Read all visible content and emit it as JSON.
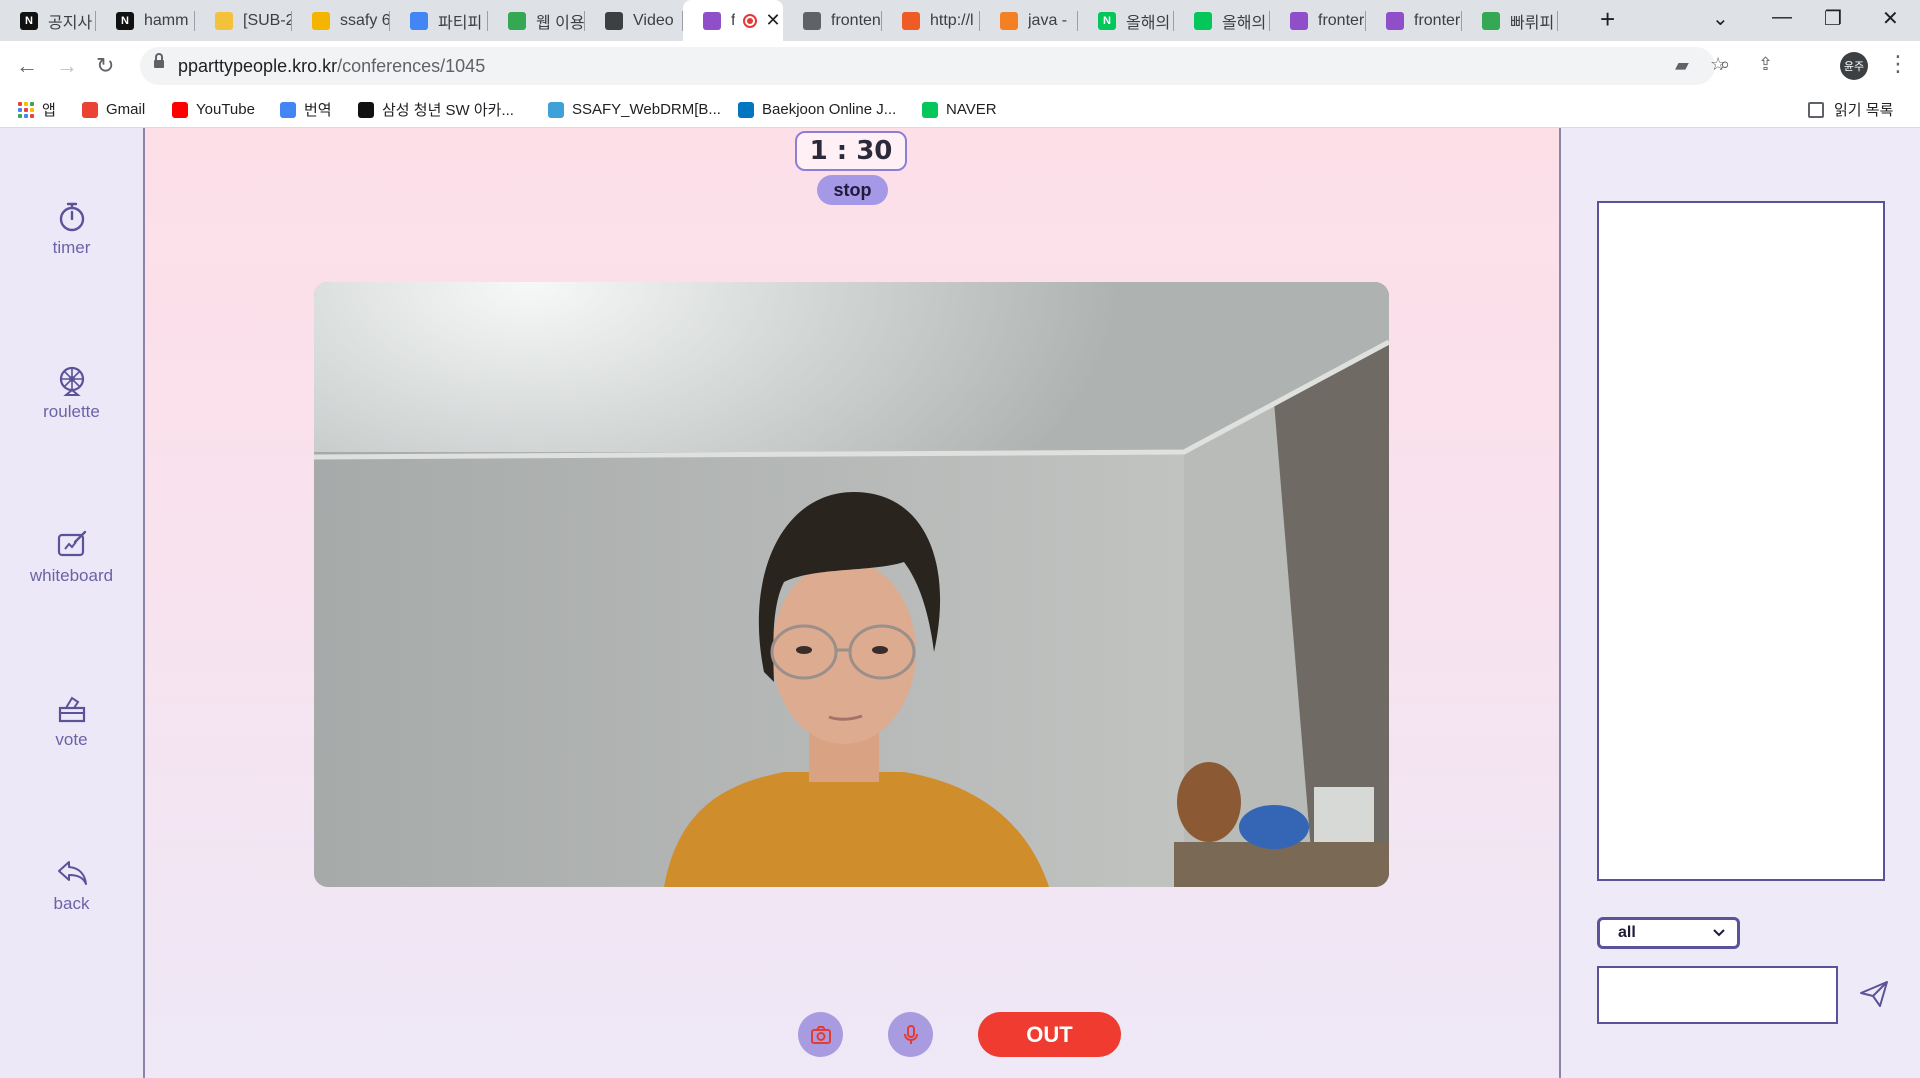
{
  "browser": {
    "tabs": [
      {
        "label": "공지사",
        "icon": "notion-icon",
        "color": "#111111",
        "glyph": "N"
      },
      {
        "label": "hamm",
        "icon": "notion-icon",
        "color": "#111111",
        "glyph": "N"
      },
      {
        "label": "[SUB-2",
        "icon": "emoji-icon",
        "color": "#f3c23c",
        "glyph": ""
      },
      {
        "label": "ssafy 6",
        "icon": "slides-icon",
        "color": "#f4b400",
        "glyph": ""
      },
      {
        "label": "파티피",
        "icon": "docs-icon",
        "color": "#4285f4",
        "glyph": ""
      },
      {
        "label": "웹 이용",
        "icon": "drive-icon",
        "color": "#34a853",
        "glyph": ""
      },
      {
        "label": "Video",
        "icon": "video-icon",
        "color": "#3c4043",
        "glyph": ""
      },
      {
        "label": "f",
        "icon": "app-logo-icon",
        "color": "#8e4fc8",
        "glyph": "",
        "active": true
      },
      {
        "label": "fronten",
        "icon": "globe-icon",
        "color": "#5f6368",
        "glyph": ""
      },
      {
        "label": "http://l",
        "icon": "postman-icon",
        "color": "#ef5b25",
        "glyph": ""
      },
      {
        "label": "java -",
        "icon": "stackoverflow-icon",
        "color": "#f48024",
        "glyph": ""
      },
      {
        "label": "올해의",
        "icon": "naver-icon",
        "color": "#03c75a",
        "glyph": "N"
      },
      {
        "label": "올해의",
        "icon": "blog-icon",
        "color": "#03c75a",
        "glyph": ""
      },
      {
        "label": "fronter",
        "icon": "app-logo-icon",
        "color": "#8e4fc8",
        "glyph": ""
      },
      {
        "label": "fronter",
        "icon": "app-logo-icon",
        "color": "#8e4fc8",
        "glyph": ""
      },
      {
        "label": "빠뤼피",
        "icon": "drive-icon",
        "color": "#34a853",
        "glyph": ""
      }
    ],
    "url_domain": "pparttypeople.kro.kr",
    "url_path": "/conferences/1045",
    "profile_initials": "윤주",
    "bookmarks": [
      {
        "label": "앱",
        "icon": "apps-icon",
        "color": ""
      },
      {
        "label": "Gmail",
        "icon": "gmail-icon",
        "color": "#ea4335"
      },
      {
        "label": "YouTube",
        "icon": "youtube-icon",
        "color": "#ff0000"
      },
      {
        "label": "번역",
        "icon": "translate-icon",
        "color": "#4285f4"
      },
      {
        "label": "삼성 청년 SW 아카...",
        "icon": "notion-icon",
        "color": "#111111"
      },
      {
        "label": "SSAFY_WebDRM[B...",
        "icon": "ssafy-icon",
        "color": "#3ea2d9"
      },
      {
        "label": "Baekjoon Online J...",
        "icon": "code-icon",
        "color": "#0076c0"
      },
      {
        "label": "NAVER",
        "icon": "naver-icon",
        "color": "#03c75a"
      }
    ],
    "reading_list": "읽기 목록"
  },
  "sidebar": {
    "items": [
      {
        "label": "timer",
        "icon": "stopwatch-icon"
      },
      {
        "label": "roulette",
        "icon": "roulette-icon"
      },
      {
        "label": "whiteboard",
        "icon": "whiteboard-icon"
      },
      {
        "label": "vote",
        "icon": "ballot-box-icon"
      },
      {
        "label": "back",
        "icon": "back-arrow-icon"
      }
    ]
  },
  "timer": {
    "display": "1 : 30",
    "stop_label": "stop"
  },
  "controls": {
    "camera_icon": "camera-icon",
    "mic_icon": "microphone-icon",
    "out_label": "OUT"
  },
  "chat": {
    "scope_selected": "all",
    "input_value": "",
    "send_icon": "paper-plane-icon"
  },
  "colors": {
    "accent": "#a598e6",
    "border": "#5b5399",
    "danger": "#ef3b30",
    "stage_pink": "#fddfe8",
    "sidebar_text": "#6a64a6"
  }
}
